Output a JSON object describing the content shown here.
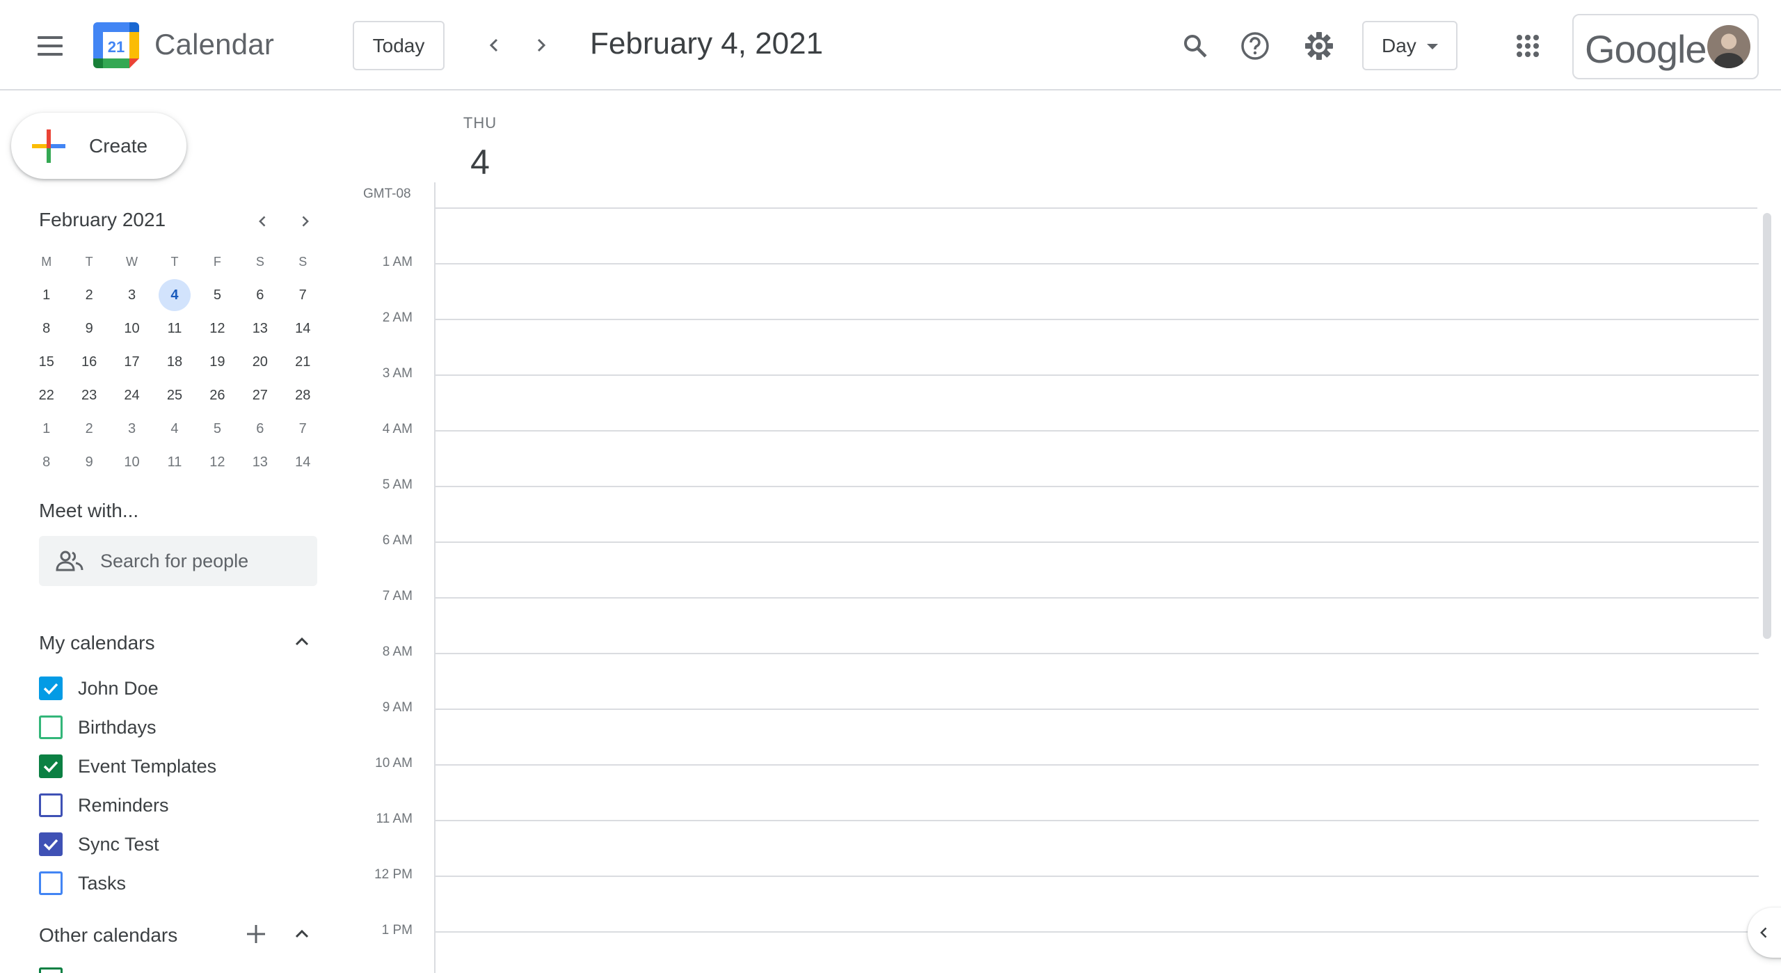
{
  "header": {
    "app_title": "Calendar",
    "logo_day": "21",
    "today_label": "Today",
    "current_date": "February 4, 2021",
    "view_label": "Day",
    "brand_word": "Google",
    "icons": [
      "menu-icon",
      "prev-icon",
      "next-icon",
      "search-icon",
      "help-icon",
      "settings-icon",
      "apps-icon"
    ]
  },
  "sidebar": {
    "create_label": "Create",
    "mini_calendar": {
      "title": "February 2021",
      "weekdays": [
        "M",
        "T",
        "W",
        "T",
        "F",
        "S",
        "S"
      ],
      "selected_day": "4",
      "weeks": [
        [
          "1",
          "2",
          "3",
          "4",
          "5",
          "6",
          "7"
        ],
        [
          "8",
          "9",
          "10",
          "11",
          "12",
          "13",
          "14"
        ],
        [
          "15",
          "16",
          "17",
          "18",
          "19",
          "20",
          "21"
        ],
        [
          "22",
          "23",
          "24",
          "25",
          "26",
          "27",
          "28"
        ],
        [
          "1",
          "2",
          "3",
          "4",
          "5",
          "6",
          "7"
        ],
        [
          "8",
          "9",
          "10",
          "11",
          "12",
          "13",
          "14"
        ]
      ]
    },
    "meet_title": "Meet with...",
    "people_placeholder": "Search for people",
    "my_calendars_title": "My calendars",
    "my_calendars": [
      {
        "label": "John Doe",
        "checked": true,
        "color": "#039be5"
      },
      {
        "label": "Birthdays",
        "checked": false,
        "color": "#33b679"
      },
      {
        "label": "Event Templates",
        "checked": true,
        "color": "#0b8043"
      },
      {
        "label": "Reminders",
        "checked": false,
        "color": "#3f51b5"
      },
      {
        "label": "Sync Test",
        "checked": true,
        "color": "#3f51b5"
      },
      {
        "label": "Tasks",
        "checked": false,
        "color": "#4285f4"
      }
    ],
    "other_calendars_title": "Other calendars"
  },
  "day_view": {
    "weekday": "THU",
    "day_number": "4",
    "timezone": "GMT-08",
    "hours": [
      "1 AM",
      "2 AM",
      "3 AM",
      "4 AM",
      "5 AM",
      "6 AM",
      "7 AM",
      "8 AM",
      "9 AM",
      "10 AM",
      "11 AM",
      "12 PM",
      "1 PM"
    ]
  }
}
